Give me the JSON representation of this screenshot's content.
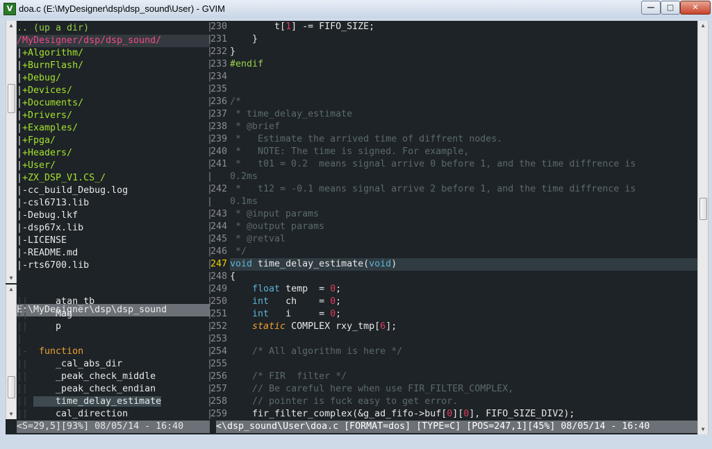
{
  "window": {
    "title": "doa.c (E:\\MyDesigner\\dsp\\dsp_sound\\User) - GVIM",
    "icon": "vim-icon",
    "buttons": {
      "minimize": "—",
      "maximize": "□",
      "close": "✕"
    }
  },
  "tree": {
    "rows": [
      {
        "kind": "updir",
        "text": ".. (up a dir)"
      },
      {
        "kind": "root",
        "text": "/MyDesigner/dsp/dsp_sound/"
      },
      {
        "kind": "dir",
        "pipe": "|",
        "text": "+Algorithm/"
      },
      {
        "kind": "dir",
        "pipe": "|",
        "text": "+BurnFlash/"
      },
      {
        "kind": "dir",
        "pipe": "|",
        "text": "+Debug/"
      },
      {
        "kind": "dir",
        "pipe": "|",
        "text": "+Devices/"
      },
      {
        "kind": "dir",
        "pipe": "|",
        "text": "+Documents/"
      },
      {
        "kind": "dir",
        "pipe": "|",
        "text": "+Drivers/"
      },
      {
        "kind": "dir",
        "pipe": "|",
        "text": "+Examples/"
      },
      {
        "kind": "dir",
        "pipe": "|",
        "text": "+Fpga/"
      },
      {
        "kind": "dir",
        "pipe": "|",
        "text": "+Headers/"
      },
      {
        "kind": "dir",
        "pipe": "|",
        "text": "+User/"
      },
      {
        "kind": "dir",
        "pipe": "|",
        "text": "+ZX_DSP_V1.CS_/"
      },
      {
        "kind": "file",
        "pipe": "|",
        "text": "-cc_build_Debug.log"
      },
      {
        "kind": "file",
        "pipe": "|",
        "text": "-csl6713.lib"
      },
      {
        "kind": "file",
        "pipe": "|",
        "text": "-Debug.lkf"
      },
      {
        "kind": "file",
        "pipe": "|",
        "text": "-dsp67x.lib"
      },
      {
        "kind": "file",
        "pipe": "|",
        "text": "-LICENSE"
      },
      {
        "kind": "file",
        "pipe": "|",
        "text": "-README.md"
      },
      {
        "kind": "file",
        "pipe": "|",
        "text": "-rts6700.lib"
      }
    ],
    "status": "E:\\MyDesigner\\dsp\\dsp_sound"
  },
  "tags": {
    "rows": [
      {
        "pipe": "||",
        "text": "    atan_tb",
        "kind": "item"
      },
      {
        "pipe": "||",
        "text": "    Mag",
        "kind": "item"
      },
      {
        "pipe": "||",
        "text": "    p",
        "kind": "item"
      },
      {
        "pipe": "|",
        "text": "",
        "kind": "item"
      },
      {
        "pipe": "|-",
        "text": " function",
        "kind": "kind"
      },
      {
        "pipe": "||",
        "text": "    _cal_abs_dir",
        "kind": "item"
      },
      {
        "pipe": "||",
        "text": "    _peak_check_middle",
        "kind": "item"
      },
      {
        "pipe": "||",
        "text": "    _peak_check_endian",
        "kind": "item"
      },
      {
        "pipe": "||",
        "text": "    time_delay_estimate",
        "kind": "sel"
      },
      {
        "pipe": "||",
        "text": "    cal_direction",
        "kind": "item"
      }
    ],
    "status": "<S=29,5][93%] 08/05/14 - 16:40"
  },
  "editor": {
    "status": "<\\dsp_sound\\User\\doa.c [FORMAT=dos] [TYPE=C] [POS=247,1][45%] 08/05/14 - 16:40",
    "current_line": "247",
    "lines": [
      {
        "n": "230",
        "segs": [
          {
            "c": "c-punct",
            "t": "        t["
          },
          {
            "c": "c-num",
            "t": "1"
          },
          {
            "c": "c-punct",
            "t": "] -= FIFO_SIZE;"
          }
        ]
      },
      {
        "n": "231",
        "segs": [
          {
            "c": "c-punct",
            "t": "    }"
          }
        ]
      },
      {
        "n": "232",
        "segs": [
          {
            "c": "c-punct",
            "t": "}"
          }
        ]
      },
      {
        "n": "233",
        "segs": [
          {
            "c": "c-pre",
            "t": "#endif"
          }
        ]
      },
      {
        "n": "234",
        "segs": []
      },
      {
        "n": "235",
        "segs": []
      },
      {
        "n": "236",
        "segs": [
          {
            "c": "c-comment",
            "t": "/*"
          }
        ]
      },
      {
        "n": "237",
        "segs": [
          {
            "c": "c-comment",
            "t": " * time_delay_estimate"
          }
        ]
      },
      {
        "n": "238",
        "segs": [
          {
            "c": "c-comment",
            "t": " * @brief"
          }
        ]
      },
      {
        "n": "239",
        "segs": [
          {
            "c": "c-comment",
            "t": " *   Estimate the arrived time of diffrent nodes."
          }
        ]
      },
      {
        "n": "240",
        "segs": [
          {
            "c": "c-comment",
            "t": " *   NOTE: The time is signed. For example,"
          }
        ]
      },
      {
        "n": "241",
        "segs": [
          {
            "c": "c-comment",
            "t": " *   t01 = 0.2  means signal arrive 0 before 1, and the time diffrence is"
          }
        ]
      },
      {
        "n": "",
        "segs": [
          {
            "c": "c-comment",
            "t": "0.2ms"
          }
        ]
      },
      {
        "n": "242",
        "segs": [
          {
            "c": "c-comment",
            "t": " *   t12 = -0.1 means signal arrive 2 before 1, and the time diffrence is"
          }
        ]
      },
      {
        "n": "",
        "segs": [
          {
            "c": "c-comment",
            "t": "0.1ms"
          }
        ]
      },
      {
        "n": "243",
        "segs": [
          {
            "c": "c-comment",
            "t": " * @input params"
          }
        ]
      },
      {
        "n": "244",
        "segs": [
          {
            "c": "c-comment",
            "t": " * @output params"
          }
        ]
      },
      {
        "n": "245",
        "segs": [
          {
            "c": "c-comment",
            "t": " * @retval"
          }
        ]
      },
      {
        "n": "246",
        "segs": [
          {
            "c": "c-comment",
            "t": " */"
          }
        ]
      },
      {
        "n": "247",
        "segs": [
          {
            "c": "c-type",
            "t": "void"
          },
          {
            "c": "c-punct",
            "t": " time_delay_estimate("
          },
          {
            "c": "c-type",
            "t": "void"
          },
          {
            "c": "c-punct",
            "t": ")"
          }
        ]
      },
      {
        "n": "248",
        "segs": [
          {
            "c": "c-punct",
            "t": "{"
          }
        ]
      },
      {
        "n": "249",
        "segs": [
          {
            "c": "c-punct",
            "t": "    "
          },
          {
            "c": "c-type",
            "t": "float"
          },
          {
            "c": "c-punct",
            "t": " temp  = "
          },
          {
            "c": "c-num",
            "t": "0"
          },
          {
            "c": "c-punct",
            "t": ";"
          }
        ]
      },
      {
        "n": "250",
        "segs": [
          {
            "c": "c-punct",
            "t": "    "
          },
          {
            "c": "c-type",
            "t": "int"
          },
          {
            "c": "c-punct",
            "t": "   ch    = "
          },
          {
            "c": "c-num",
            "t": "0"
          },
          {
            "c": "c-punct",
            "t": ";"
          }
        ]
      },
      {
        "n": "251",
        "segs": [
          {
            "c": "c-punct",
            "t": "    "
          },
          {
            "c": "c-type",
            "t": "int"
          },
          {
            "c": "c-punct",
            "t": "   i     = "
          },
          {
            "c": "c-num",
            "t": "0"
          },
          {
            "c": "c-punct",
            "t": ";"
          }
        ]
      },
      {
        "n": "252",
        "segs": [
          {
            "c": "c-punct",
            "t": "    "
          },
          {
            "c": "c-static",
            "t": "static"
          },
          {
            "c": "c-punct",
            "t": " COMPLEX rxy_tmp["
          },
          {
            "c": "c-num",
            "t": "6"
          },
          {
            "c": "c-punct",
            "t": "];"
          }
        ]
      },
      {
        "n": "253",
        "segs": []
      },
      {
        "n": "254",
        "segs": [
          {
            "c": "c-punct",
            "t": "    "
          },
          {
            "c": "c-comment",
            "t": "/* All algorithm is here */"
          }
        ]
      },
      {
        "n": "255",
        "segs": []
      },
      {
        "n": "256",
        "segs": [
          {
            "c": "c-punct",
            "t": "    "
          },
          {
            "c": "c-comment",
            "t": "/* FIR  filter */"
          }
        ]
      },
      {
        "n": "257",
        "segs": [
          {
            "c": "c-punct",
            "t": "    "
          },
          {
            "c": "c-comment",
            "t": "// Be careful here when use FIR_FILTER_COMPLEX,"
          }
        ]
      },
      {
        "n": "258",
        "segs": [
          {
            "c": "c-punct",
            "t": "    "
          },
          {
            "c": "c-comment",
            "t": "// pointer is fuck easy to get error."
          }
        ]
      },
      {
        "n": "259",
        "segs": [
          {
            "c": "c-punct",
            "t": "    fir_filter_complex(&g_ad_fifo->buf["
          },
          {
            "c": "c-num",
            "t": "0"
          },
          {
            "c": "c-punct",
            "t": "]["
          },
          {
            "c": "c-num",
            "t": "0"
          },
          {
            "c": "c-punct",
            "t": "], FIFO_SIZE_DIV2);"
          }
        ]
      }
    ]
  },
  "scroll": {
    "tree_position": 0.25,
    "tags_position": 0.88,
    "editor_position": 0.45
  }
}
